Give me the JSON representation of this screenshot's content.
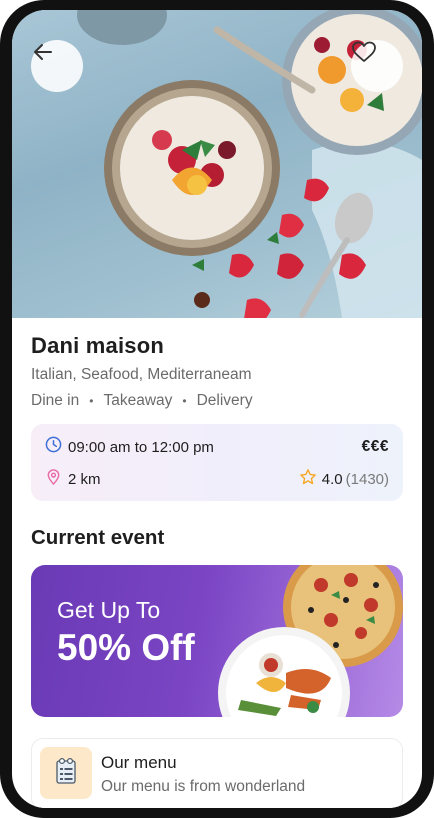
{
  "restaurant": {
    "name": "Dani maison",
    "cuisines": "Italian, Seafood, Mediterraneam",
    "services": [
      "Dine in",
      "Takeaway",
      "Delivery"
    ],
    "hours": "09:00 am to 12:00 pm",
    "price_level": "€€€",
    "distance": "2 km",
    "rating": "4.0",
    "reviews": "(1430)"
  },
  "events": {
    "section_title": "Current event",
    "promo_line1": "Get Up To",
    "promo_line2": "50% Off"
  },
  "menu": {
    "title": "Our menu",
    "subtitle": "Our menu is from wonderland"
  },
  "icons": {
    "back": "arrow-left-icon",
    "favorite": "heart-icon",
    "clock": "clock-icon",
    "location": "location-pin-icon",
    "star": "star-icon",
    "menu": "menu-book-icon"
  },
  "colors": {
    "accent_purple": "#7b45c4",
    "clock_blue": "#3d6fd6",
    "pin_pink": "#e96aa8",
    "star_orange": "#f5a623"
  }
}
